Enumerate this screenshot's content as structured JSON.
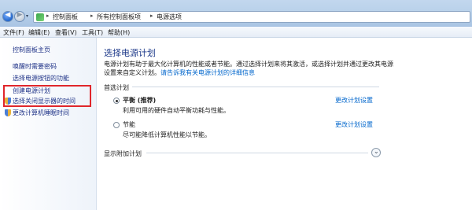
{
  "address_bar": {
    "crumbs": [
      "控制面板",
      "所有控制面板项",
      "电源选项"
    ]
  },
  "menu": {
    "items": [
      "文件(F)",
      "编辑(E)",
      "查看(V)",
      "工具(T)",
      "帮助(H)"
    ]
  },
  "sidebar": {
    "home": "控制面板主页",
    "items": [
      {
        "label": "唤醒时需要密码"
      },
      {
        "label": "选择电源按钮的功能"
      },
      {
        "label": "创建电源计划"
      },
      {
        "label": "选择关闭显示器的时间",
        "icon": "shield-icon",
        "highlighted": true
      },
      {
        "label": "更改计算机睡眠时间",
        "icon": "shield-icon"
      }
    ]
  },
  "main": {
    "title": "选择电源计划",
    "description": "电源计划有助于最大化计算机的性能或者节能。通过选择计划来将其激活，或选择计划并通过更改其电源设置来自定义计划。",
    "description_link": "请告诉我有关电源计划的详细信息",
    "preferred_label": "首选计划",
    "plans": [
      {
        "name": "平衡 (推荐)",
        "desc": "利用可用的硬件自动平衡功耗与性能。",
        "link": "更改计划设置",
        "selected": true
      },
      {
        "name": "节能",
        "desc": "尽可能降低计算机性能以节能。",
        "link": "更改计划设置",
        "selected": false
      }
    ],
    "show_more": "显示附加计划"
  },
  "colors": {
    "link": "#0066cc",
    "sidebar_link": "#1e3287",
    "highlight_box": "#e0262b",
    "title": "#1e3a8a"
  }
}
